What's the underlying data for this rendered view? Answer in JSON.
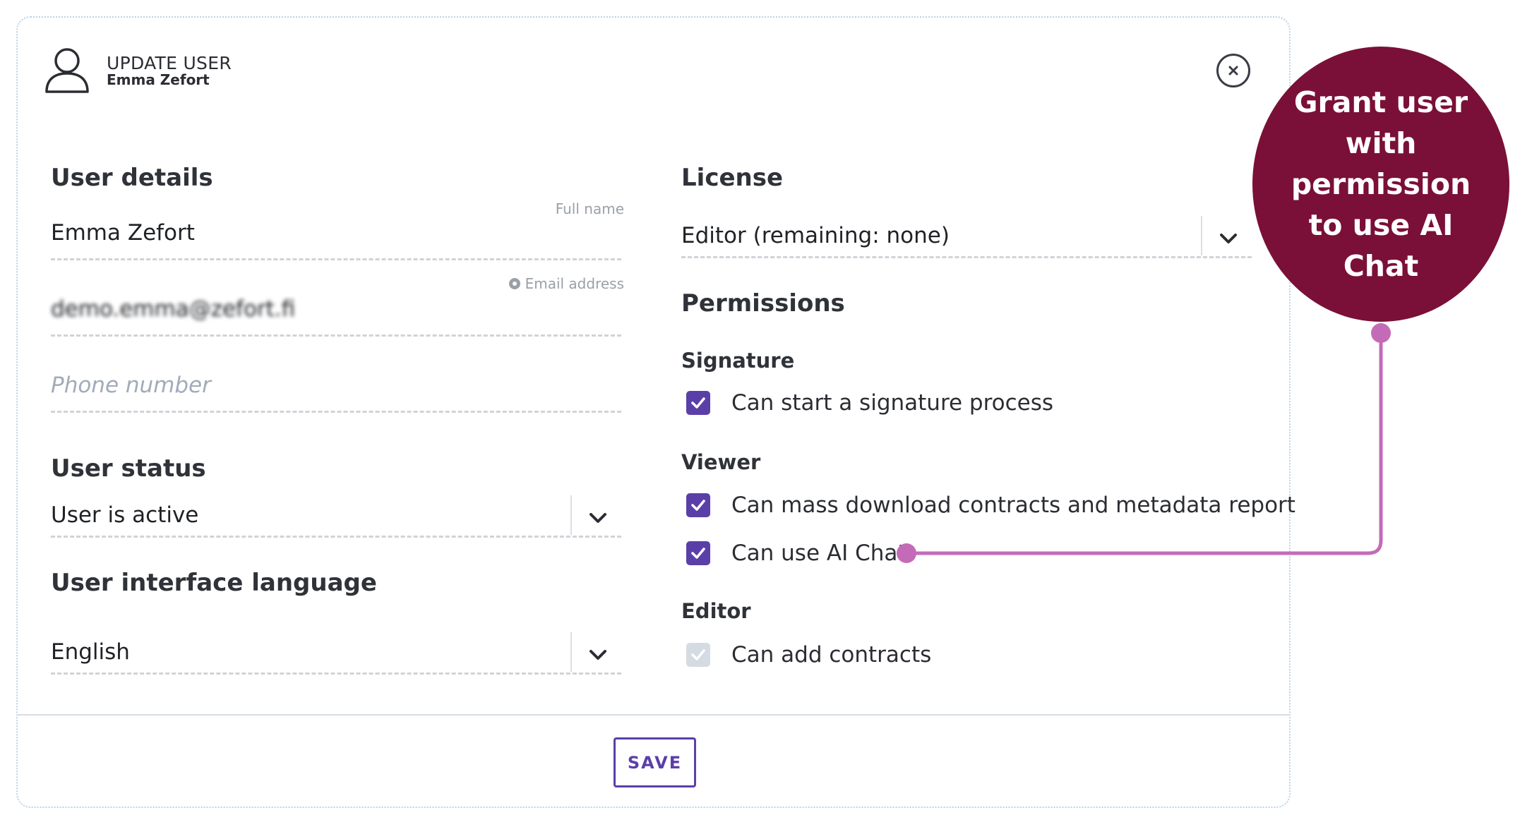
{
  "header": {
    "title": "UPDATE USER",
    "subtitle": "Emma Zefort"
  },
  "user_details": {
    "heading": "User details",
    "full_name": {
      "hint": "Full name",
      "value": "Emma Zefort"
    },
    "email": {
      "hint": "Email address",
      "value": "demo.emma@zefort.fi"
    },
    "phone": {
      "placeholder": "Phone number",
      "value": ""
    }
  },
  "user_status": {
    "heading": "User status",
    "selected": "User is active"
  },
  "language": {
    "heading": "User interface language",
    "selected": "English"
  },
  "license": {
    "heading": "License",
    "selected": "Editor (remaining: none)"
  },
  "permissions": {
    "heading": "Permissions",
    "groups": [
      {
        "heading": "Signature",
        "items": [
          {
            "label": "Can start a signature process",
            "checked": true,
            "disabled": false
          }
        ]
      },
      {
        "heading": "Viewer",
        "items": [
          {
            "label": "Can mass download contracts and metadata report",
            "checked": true,
            "disabled": false
          },
          {
            "label": "Can use AI Chat",
            "checked": true,
            "disabled": false
          }
        ]
      },
      {
        "heading": "Editor",
        "items": [
          {
            "label": "Can add contracts",
            "checked": true,
            "disabled": true
          }
        ]
      }
    ]
  },
  "footer": {
    "save_label": "SAVE"
  },
  "callout": {
    "text": "Grant user with permission to use AI Chat"
  },
  "colors": {
    "accent": "#5b3fa8",
    "callout": "#7a1037",
    "connector": "#c46bb8"
  }
}
